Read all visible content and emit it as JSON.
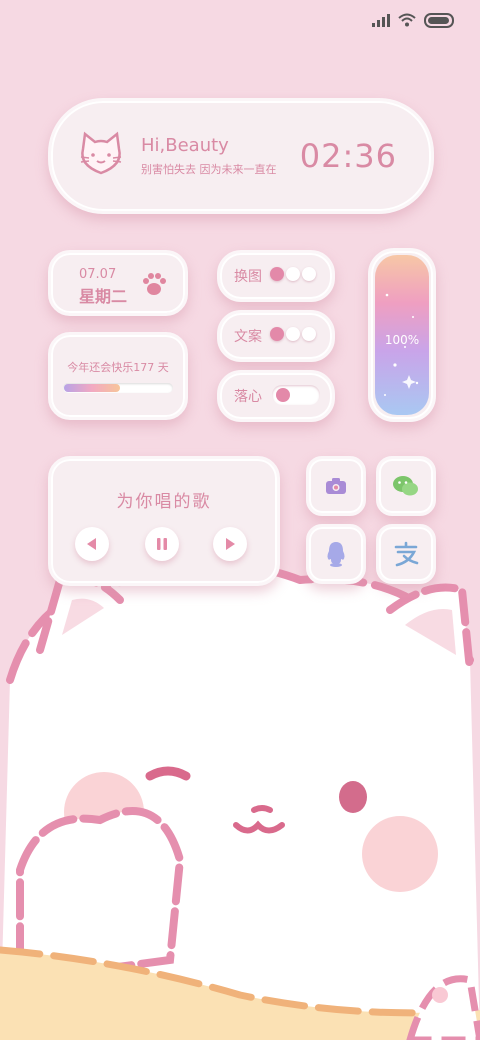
{
  "header": {
    "greeting": "Hi,Beauty",
    "subtitle": "别害怕失去 因为未来一直在",
    "time": "02:36"
  },
  "date_widget": {
    "date": "07.07",
    "weekday": "星期二"
  },
  "countdown_widget": {
    "text": "今年还会快乐177 天",
    "progress": 0.52
  },
  "toggles": [
    {
      "label": "换图",
      "style": "dots"
    },
    {
      "label": "文案",
      "style": "dots"
    },
    {
      "label": "落心",
      "style": "switch"
    }
  ],
  "battery_widget": {
    "percent": "100%"
  },
  "music_widget": {
    "title": "为你唱的歌",
    "prev_icon": "prev-icon",
    "pause_icon": "pause-icon",
    "next_icon": "next-icon"
  },
  "apps": [
    {
      "name": "camera",
      "icon": "camera-icon",
      "color": "#a98bd6"
    },
    {
      "name": "wechat",
      "icon": "wechat-icon",
      "color": "#7cc56a"
    },
    {
      "name": "qq",
      "icon": "qq-icon",
      "color": "#a6a9e8"
    },
    {
      "name": "alipay",
      "icon": "alipay-icon",
      "color": "#7aa7d6"
    }
  ],
  "colors": {
    "background": "#f6d9e3",
    "accent": "#d98aa4",
    "widget": "#f7eef1"
  }
}
